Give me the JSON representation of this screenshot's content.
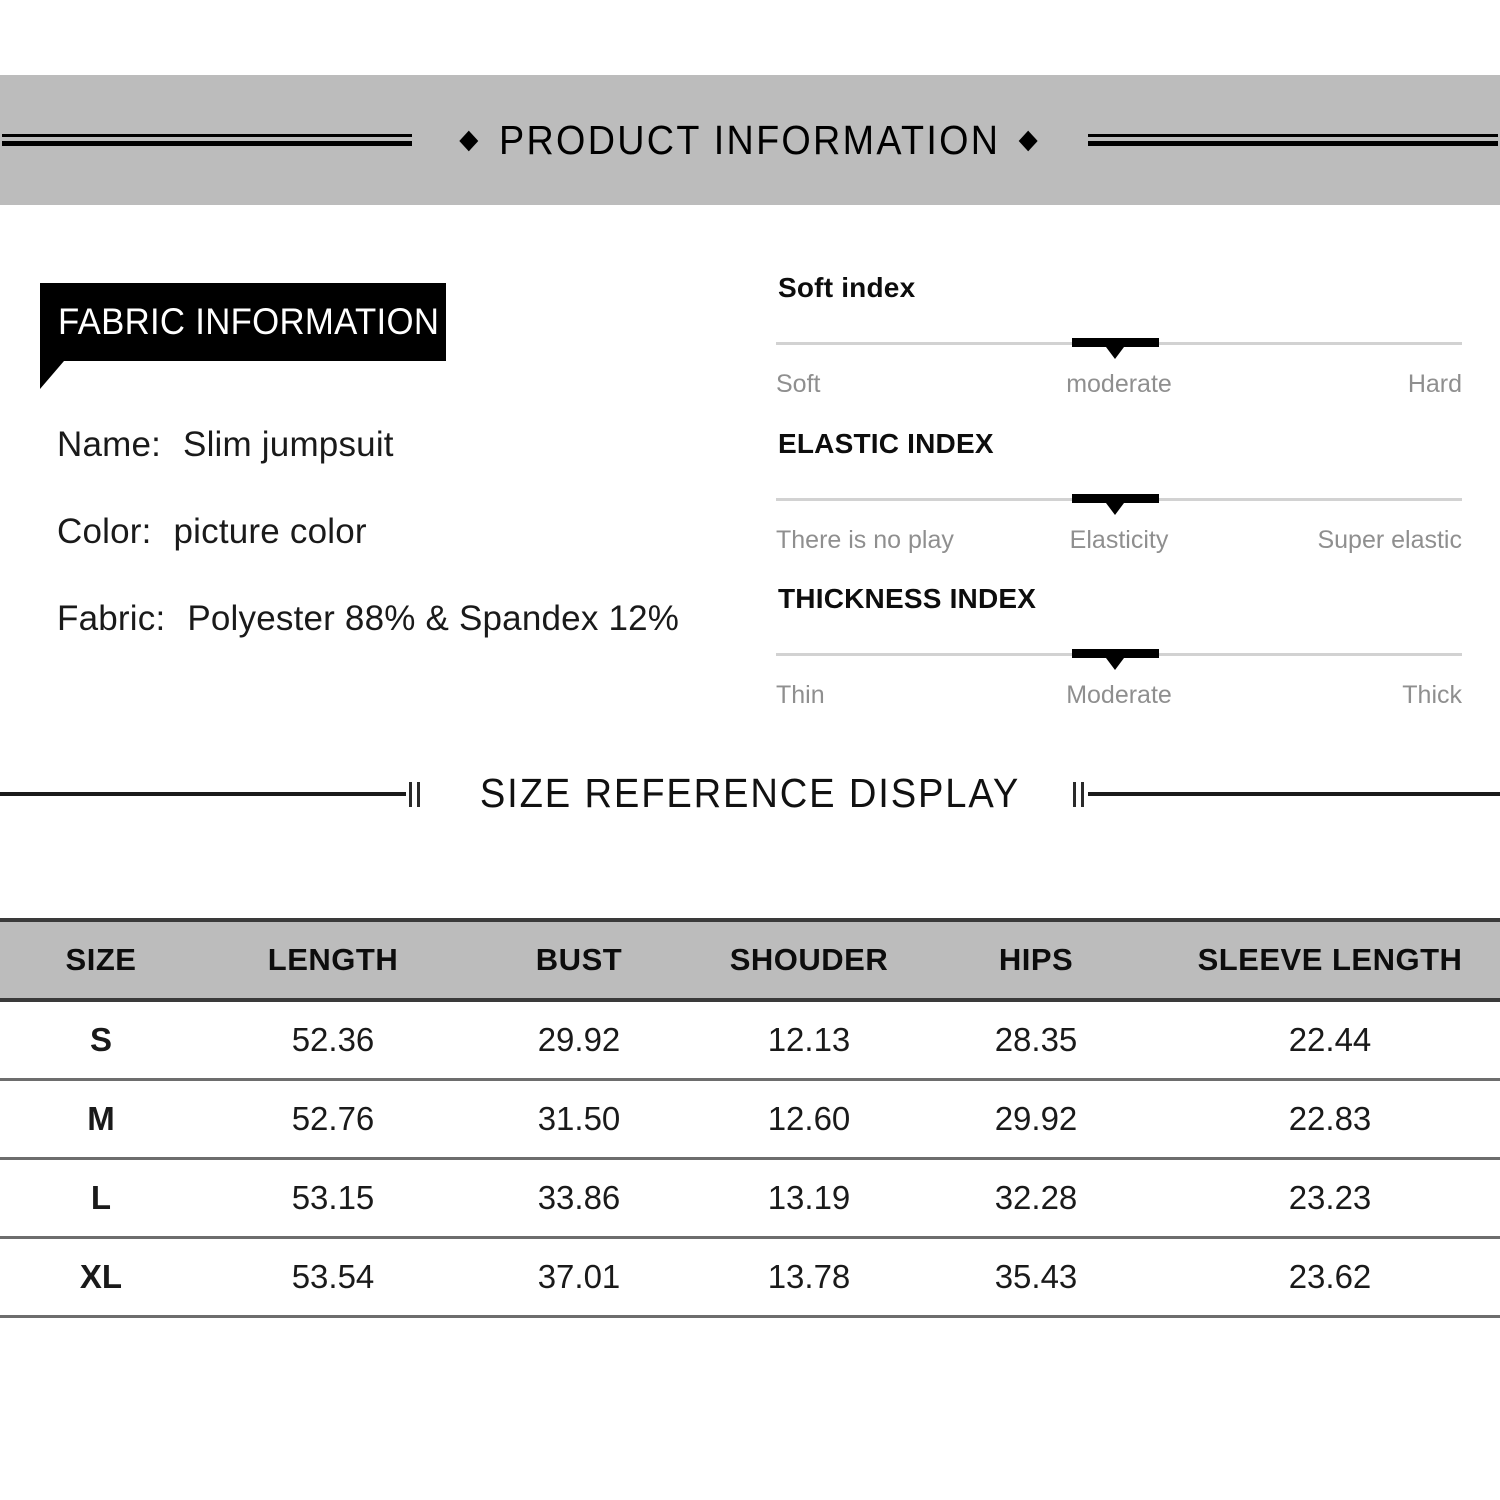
{
  "header": {
    "title": "PRODUCT INFORMATION",
    "diamond_glyph": "◆",
    "band_color": "#bcbcbc"
  },
  "fabric": {
    "tag_label": "FABRIC INFORMATION",
    "rows": [
      {
        "label": "Name:",
        "value": "Slim jumpsuit"
      },
      {
        "label": "Color:",
        "value": "picture color"
      },
      {
        "label": "Fabric:",
        "value": "Polyester 88% & Spandex 12%"
      }
    ]
  },
  "indexes": [
    {
      "title": "Soft index",
      "left_label": "Soft",
      "mid_label": "moderate",
      "right_label": "Hard",
      "value_position_percent": 50
    },
    {
      "title": "ELASTIC INDEX",
      "left_label": "There is no play",
      "mid_label": "Elasticity",
      "right_label": "Super elastic",
      "value_position_percent": 50
    },
    {
      "title": "THICKNESS INDEX",
      "left_label": "Thin",
      "mid_label": "Moderate",
      "right_label": "Thick",
      "value_position_percent": 50
    }
  ],
  "size_section": {
    "divider_title": "SIZE REFERENCE DISPLAY"
  },
  "size_table": {
    "columns": [
      "SIZE",
      "LENGTH",
      "BUST",
      "SHOUDER",
      "HIPS",
      "SLEEVE LENGTH"
    ],
    "rows": [
      {
        "size": "S",
        "length": "52.36",
        "bust": "29.92",
        "shoulder": "12.13",
        "hips": "28.35",
        "sleeve": "22.44"
      },
      {
        "size": "M",
        "length": "52.76",
        "bust": "31.50",
        "shoulder": "12.60",
        "hips": "29.92",
        "sleeve": "22.83"
      },
      {
        "size": "L",
        "length": "53.15",
        "bust": "33.86",
        "shoulder": "13.19",
        "hips": "32.28",
        "sleeve": "23.23"
      },
      {
        "size": "XL",
        "length": "53.54",
        "bust": "37.01",
        "shoulder": "13.78",
        "hips": "35.43",
        "sleeve": "23.62"
      }
    ]
  }
}
